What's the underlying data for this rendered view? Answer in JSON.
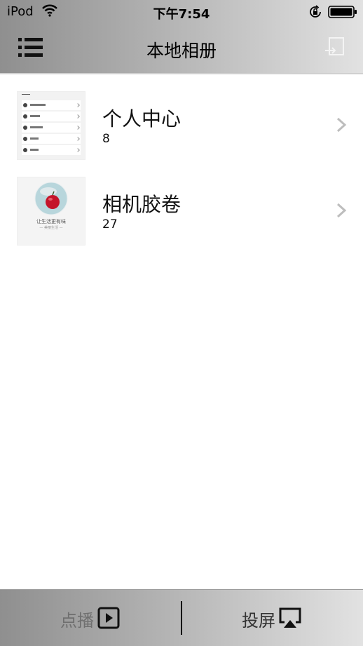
{
  "status_bar": {
    "carrier": "iPod",
    "time": "下午7:54",
    "wifi_icon": "wifi-icon",
    "lock_icon": "rotation-lock-icon",
    "battery_icon": "battery-icon"
  },
  "nav": {
    "title": "本地相册",
    "menu_icon": "menu-list-icon",
    "share_icon": "share-export-icon"
  },
  "albums": [
    {
      "name": "个人中心",
      "count": "8"
    },
    {
      "name": "相机胶卷",
      "count": "27",
      "thumb_text": "让生活更有味",
      "thumb_subtext": "— 美丽生活 —"
    }
  ],
  "tabs": [
    {
      "label": "点播",
      "icon": "play-icon",
      "state": "inactive"
    },
    {
      "label": "投屏",
      "icon": "airplay-icon",
      "state": "active"
    }
  ],
  "colors": {
    "bar_gradient_start": "#8f8f8f",
    "bar_gradient_end": "#e2e2e2",
    "tab_inactive_text": "#6f6f6f",
    "tab_active_text": "#333333",
    "chevron": "#bdbdbd"
  }
}
